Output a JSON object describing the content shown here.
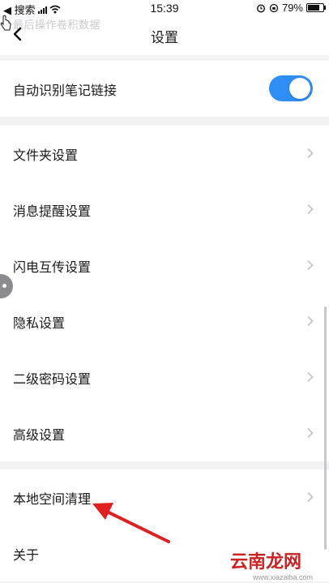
{
  "status_bar": {
    "back_app": "◀ 搜索",
    "time": "15:39",
    "battery_percent": "79%",
    "battery_level": 0.79
  },
  "nav": {
    "title": "设置",
    "ghost_text": "最后操作卷积数据"
  },
  "auto_link": {
    "label": "自动识别笔记链接",
    "enabled": true,
    "accent_color": "#2f8ef5"
  },
  "settings_items": [
    {
      "label": "文件夹设置"
    },
    {
      "label": "消息提醒设置"
    },
    {
      "label": "闪电互传设置"
    },
    {
      "label": "隐私设置"
    },
    {
      "label": "二级密码设置"
    },
    {
      "label": "高级设置"
    }
  ],
  "storage_items": [
    {
      "label": "本地空间清理"
    },
    {
      "label": "关于"
    }
  ],
  "watermark": {
    "text": "云南龙网",
    "sub": "www.xiazaiba.com"
  },
  "icons": {
    "back": "chevron-left-icon",
    "chevron": "chevron-right-icon",
    "wifi": "wifi-icon",
    "alarm": "alarm-icon"
  }
}
